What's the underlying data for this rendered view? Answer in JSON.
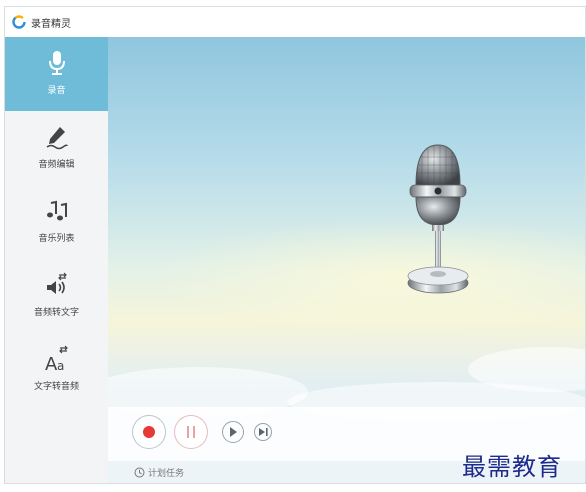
{
  "window": {
    "title": "录音精灵"
  },
  "sidebar": {
    "items": [
      {
        "label": "录音",
        "icon": "microphone-icon",
        "active": true
      },
      {
        "label": "音频编辑",
        "icon": "pen-icon",
        "active": false
      },
      {
        "label": "音乐列表",
        "icon": "music-notes-icon",
        "active": false
      },
      {
        "label": "音频转文字",
        "icon": "speaker-convert-icon",
        "active": false
      },
      {
        "label": "文字转音频",
        "icon": "text-convert-icon",
        "active": false
      }
    ]
  },
  "controls": {
    "record": "record-icon",
    "pause": "pause-icon",
    "play": "play-icon",
    "next": "skip-next-icon"
  },
  "footer": {
    "schedule_label": "计划任务"
  },
  "watermark": {
    "text": "最需教育"
  },
  "colors": {
    "accent": "#6ebcd8",
    "record_red": "#e53935",
    "pause_pink": "#e8a3a3"
  }
}
